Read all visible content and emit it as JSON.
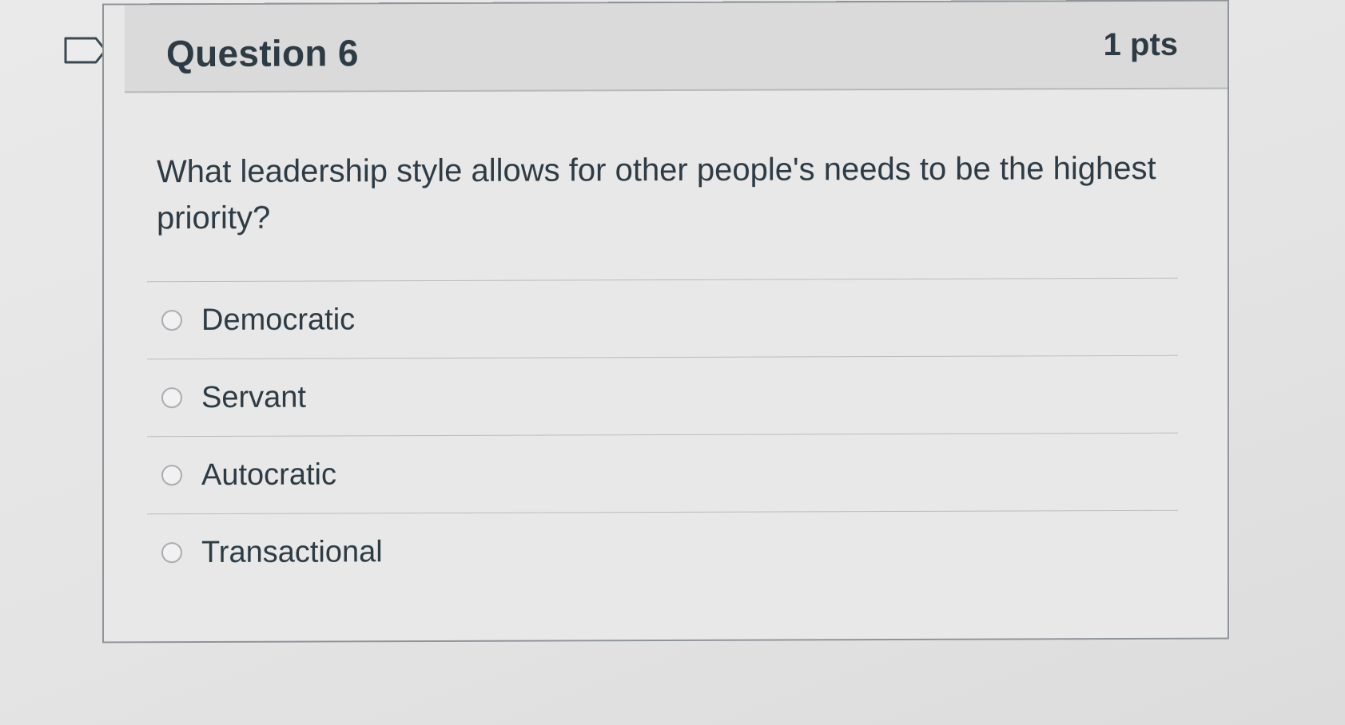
{
  "question": {
    "title": "Question 6",
    "points": "1 pts",
    "text": "What leadership style allows for other people's needs to be the highest priority?"
  },
  "answers": [
    {
      "label": "Democratic",
      "selected": false
    },
    {
      "label": "Servant",
      "selected": false
    },
    {
      "label": "Autocratic",
      "selected": false
    },
    {
      "label": "Transactional",
      "selected": false
    }
  ],
  "icons": {
    "flag": "flag-question-icon",
    "radio": "radio-circle-icon"
  }
}
